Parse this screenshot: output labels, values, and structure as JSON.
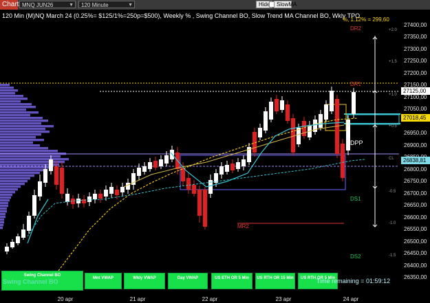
{
  "toolbar": {
    "chart_tab": "Chart",
    "symbol": "MNQ JUN26",
    "interval": "120 Minute",
    "hide_label": "Hide",
    "slowma_label": "SlowMA"
  },
  "chart": {
    "title": "120 Min (M)NQ March 24  (0.25%= $125/1%=250p=$500), Weekly % , Swing Channel BO, Slow Trend MA Channel BO, Wkly TPO",
    "top_right_readout": "%, 1.12% = 299,60",
    "axis_labels": [
      "27400,00",
      "27350,00",
      "27300,00",
      "27250,00",
      "27200,00",
      "27150,00",
      "27100,00",
      "27050,00",
      "26950,00",
      "26900,00",
      "26850,00",
      "26800,00",
      "26750,00",
      "26700,00",
      "26650,00",
      "26600,00",
      "26550,00",
      "26500,00",
      "26450,00",
      "26400,00",
      "26350,00"
    ],
    "price_boxes": {
      "upper": "27125,00",
      "current": "27018,45",
      "lower": "26838,81"
    },
    "pct_labels": [
      "+2.0",
      "+1.5",
      "+1.0",
      "+0.5",
      "CL",
      "-0.5",
      "-1.0",
      "-1.5"
    ],
    "level_labels": {
      "dr2": "DR2",
      "dr1": "DR1",
      "dpp": "DPP",
      "ds1": "DS1",
      "ds2": "DS2",
      "mr2": "MR2"
    },
    "x_labels": [
      "20 apr",
      "21 apr",
      "22 apr",
      "23 apr",
      "24 apr"
    ],
    "timer": "Time remaining = 01:59:12",
    "colors": {
      "up": "#ffffff",
      "down": "#e02020",
      "vwap_yellow": "#f0c419",
      "teal": "#38c6d6",
      "profile": "#7b68ee",
      "button_green": "#17e04a"
    }
  },
  "buttons": {
    "swing": "Swing Channel BO",
    "swing_shadow": "Swing Channel BO",
    "items": [
      "Mnt VWAP",
      "Wkly VWAP",
      "Day VWAP",
      "US ETH OR 5 Min",
      "US RTH OR 15 Min",
      "US RTH OR 5 Min"
    ]
  }
}
